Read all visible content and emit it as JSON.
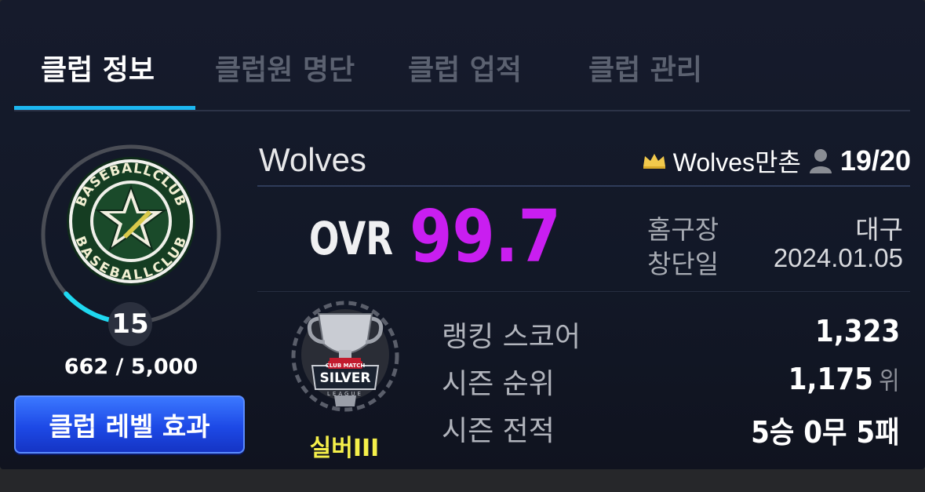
{
  "tabs": [
    {
      "label": "클럽 정보",
      "active": true
    },
    {
      "label": "클럽원 명단",
      "active": false
    },
    {
      "label": "클럽 업적",
      "active": false
    },
    {
      "label": "클럽 관리",
      "active": false
    }
  ],
  "club": {
    "name": "Wolves",
    "owner": "Wolves만촌",
    "members": "19/20",
    "emblem_text": "BASEBALLCLUB"
  },
  "level": {
    "value": "15",
    "exp": "662 / 5,000",
    "progress": 0.1324,
    "button_label": "클럽 레벨 효과"
  },
  "ovr": {
    "label": "OVR",
    "value": "99.7"
  },
  "info": {
    "stadium_label": "홈구장",
    "stadium_value": "대구",
    "founded_label": "창단일",
    "founded_value": "2024.01.05"
  },
  "league": {
    "name": "실버III",
    "emblem_title": "SILVER",
    "emblem_top": "CLUB MATCH",
    "emblem_bottom": "LEAGUE"
  },
  "stats": {
    "ranking_label": "랭킹 스코어",
    "ranking_value": "1,323",
    "season_rank_label": "시즌 순위",
    "season_rank_value": "1,175",
    "season_rank_unit": "위",
    "record_label": "시즌 전적",
    "record_value": "5승 0무 5패"
  },
  "colors": {
    "accent": "#1cb7f0",
    "ovr": "#c91ef0",
    "league": "#f5f04a",
    "progress": "#1fd8f0"
  }
}
